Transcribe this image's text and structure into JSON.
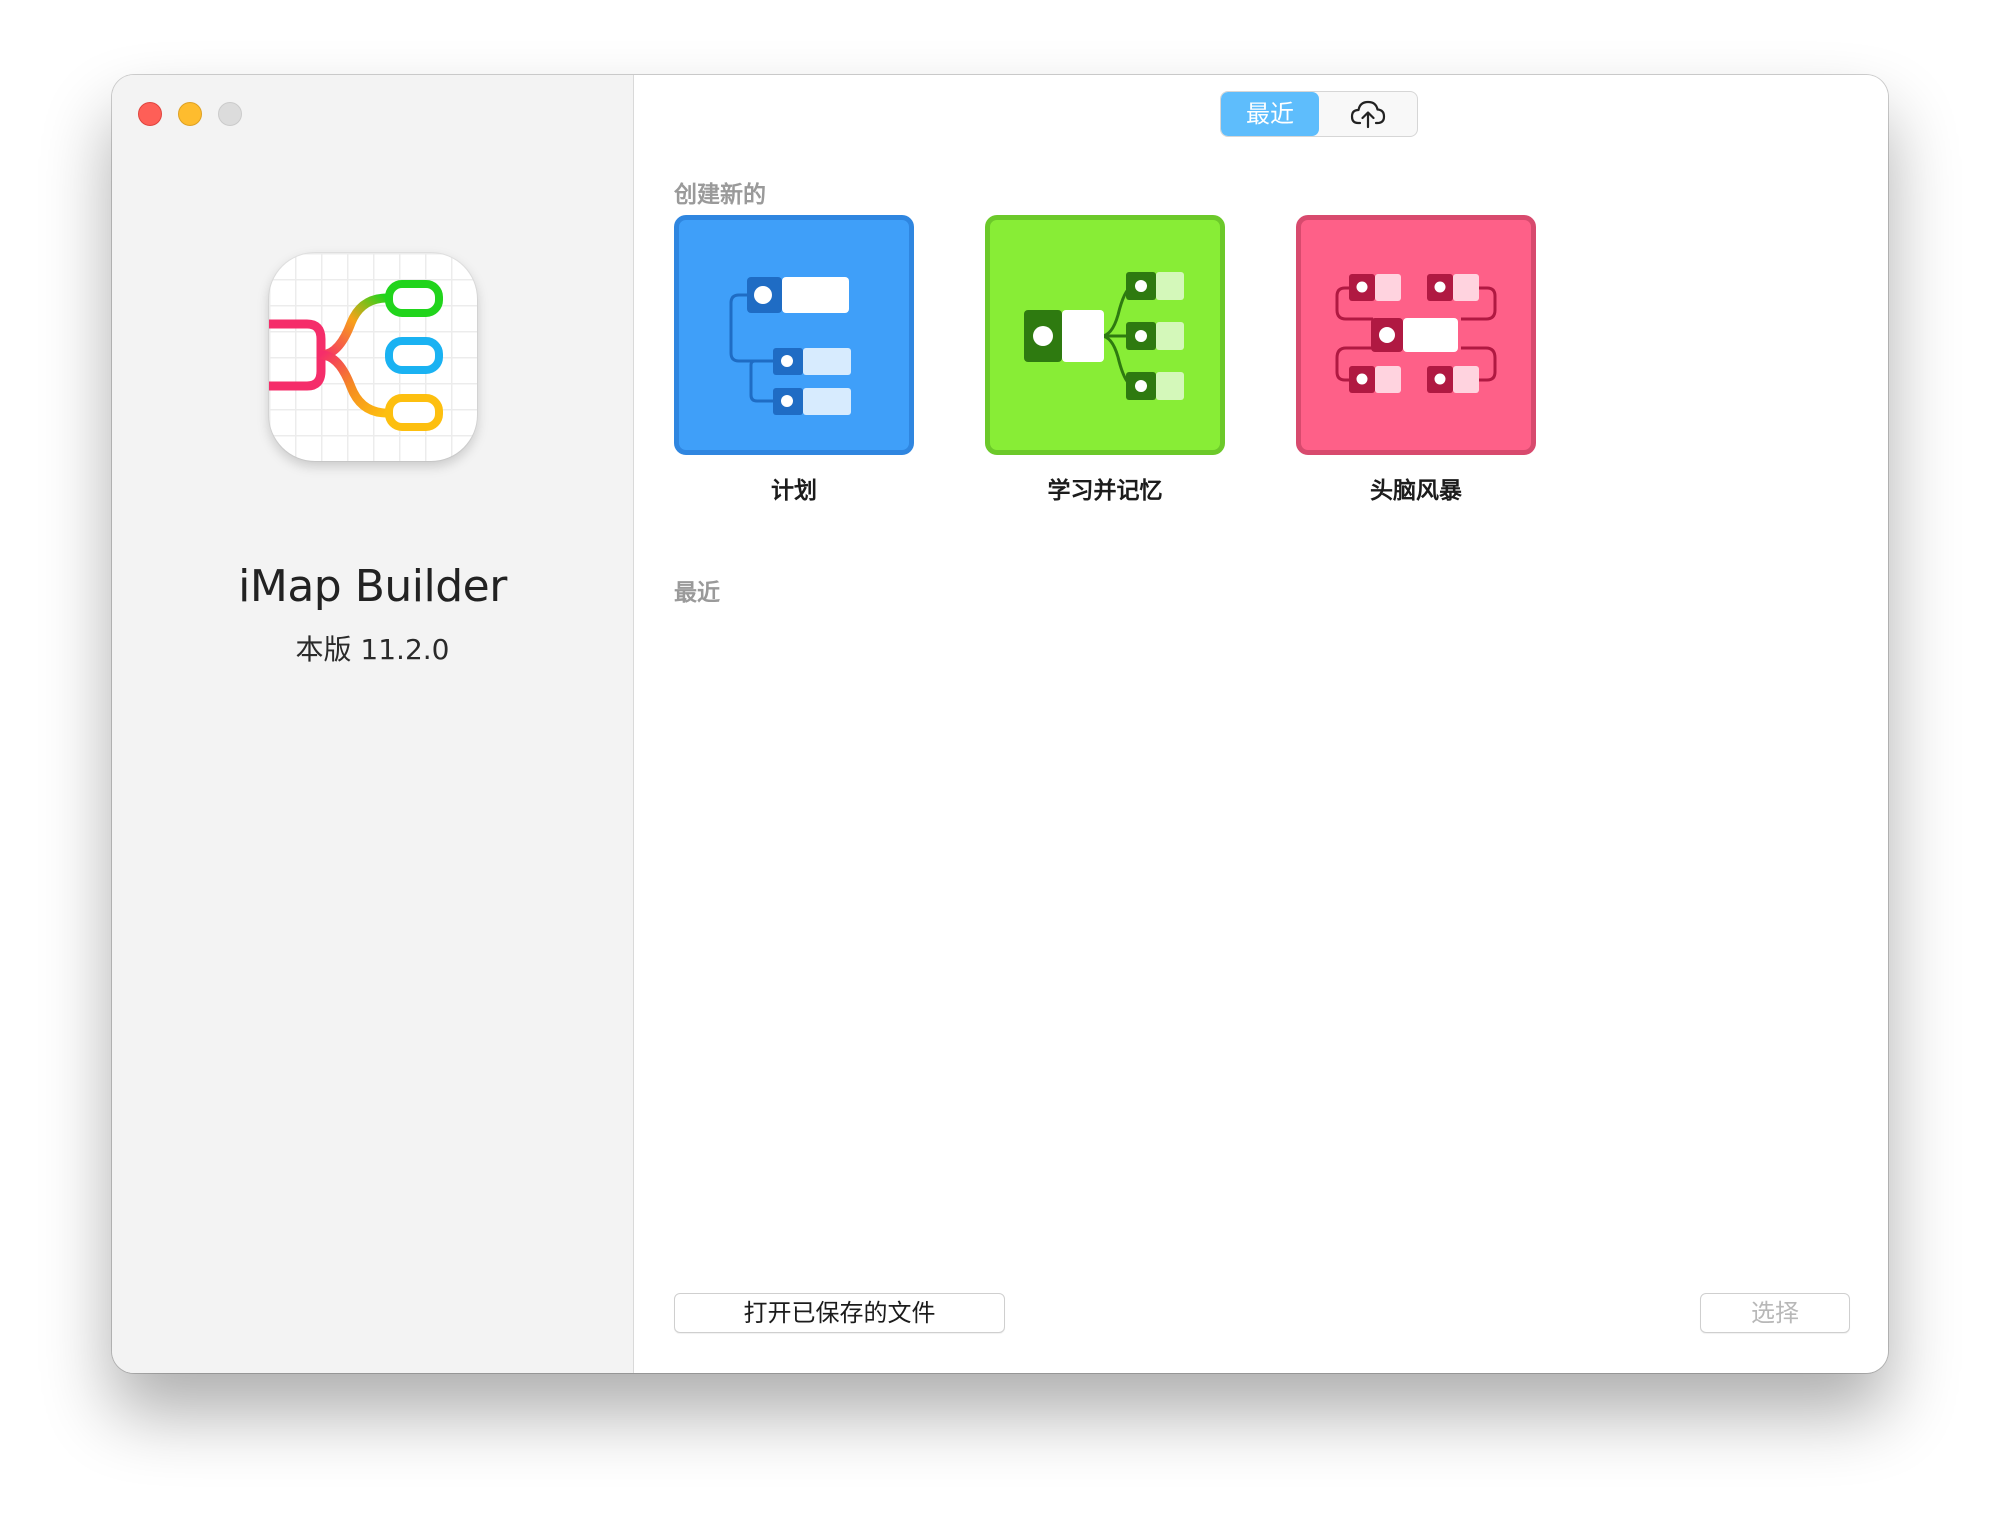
{
  "sidebar": {
    "app_name": "iMap Builder",
    "version": "本版 11.2.0"
  },
  "segmented": {
    "recent_label": "最近",
    "cloud_icon": "cloud-upload-icon"
  },
  "create_section": {
    "label": "创建新的",
    "templates": [
      {
        "label": "计划",
        "color": "#3f9ff9",
        "border": "#2f86e0"
      },
      {
        "label": "学习并记忆",
        "color": "#88ed36",
        "border": "#6cc92a"
      },
      {
        "label": "头脑风暴",
        "color": "#fe6088",
        "border": "#d84a6e"
      }
    ]
  },
  "recent_section": {
    "label": "最近"
  },
  "footer": {
    "open_label": "打开已保存的文件",
    "select_label": "选择"
  }
}
